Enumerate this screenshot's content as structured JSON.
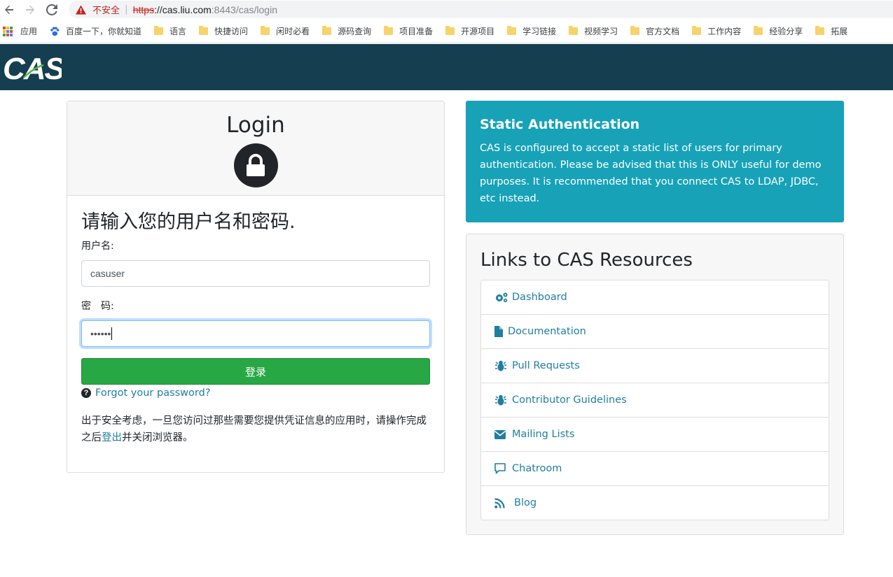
{
  "browser": {
    "insecure_label": "不安全",
    "url_scheme": "https",
    "url_host": "://cas.liu.com",
    "url_path": ":8443/cas/login"
  },
  "bookmarks": {
    "apps_label": "应用",
    "baidu_label": "百度一下，你就知道",
    "folders": [
      "语言",
      "快捷访问",
      "闲时必看",
      "源码查询",
      "项目准备",
      "开源项目",
      "学习链接",
      "视频学习",
      "官方文档",
      "工作内容",
      "经验分享",
      "拓展"
    ]
  },
  "header": {
    "logo_text": "CAS"
  },
  "login": {
    "title": "Login",
    "prompt": "请输入您的用户名和密码.",
    "username_label": "用户名:",
    "username_value": "casuser",
    "password_label": "密　码:",
    "password_value": "••••••",
    "submit_label": "登录",
    "forgot_label": "Forgot your password?",
    "notice_before": "出于安全考虑，一旦您访问过那些需要您提供凭证信息的应用时，请操作完成之后",
    "notice_link": "登出",
    "notice_after": "并关闭浏览器。"
  },
  "static_auth": {
    "title": "Static Authentication",
    "text": "CAS is configured to accept a static list of users for primary authentication. Please be advised that this is ONLY useful for demo purposes. It is recommended that you connect CAS to LDAP, JDBC, etc instead."
  },
  "resources": {
    "title": "Links to CAS Resources",
    "items": [
      {
        "label": "Dashboard",
        "icon": "cogs-icon"
      },
      {
        "label": "Documentation",
        "icon": "file-icon"
      },
      {
        "label": "Pull Requests",
        "icon": "bug-icon"
      },
      {
        "label": "Contributor Guidelines",
        "icon": "bug-icon"
      },
      {
        "label": "Mailing Lists",
        "icon": "envelope-icon"
      },
      {
        "label": "Chatroom",
        "icon": "comment-icon"
      },
      {
        "label": "Blog",
        "icon": "rss-icon"
      }
    ]
  },
  "colors": {
    "header_bg": "#153e50",
    "static_bg": "#17a2b8",
    "submit_bg": "#28a745",
    "link": "#1f7ea1"
  }
}
